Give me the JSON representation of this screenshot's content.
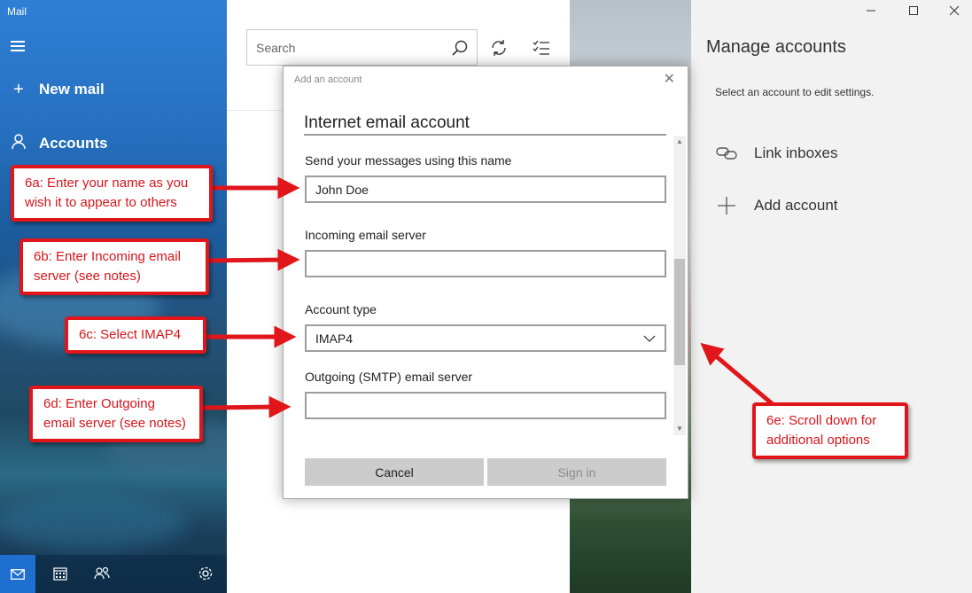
{
  "app": {
    "title": "Mail"
  },
  "nav": {
    "new_mail": "New mail",
    "accounts": "Accounts",
    "bottom_icons": [
      "mail-icon",
      "calendar-icon",
      "people-icon",
      "settings-icon"
    ]
  },
  "list": {
    "search": {
      "placeholder": "Search"
    }
  },
  "manage": {
    "title": "Manage accounts",
    "subtitle": "Select an account to edit settings.",
    "link_inboxes": "Link inboxes",
    "add_account": "Add account"
  },
  "dialog": {
    "caption": "Add an account",
    "heading": "Internet email account",
    "fields": {
      "name": {
        "label": "Send your messages using this name",
        "value": "John Doe"
      },
      "incoming": {
        "label": "Incoming email server",
        "value": ""
      },
      "account_type": {
        "label": "Account type",
        "value": "IMAP4"
      },
      "outgoing": {
        "label": "Outgoing (SMTP) email server",
        "value": ""
      }
    },
    "buttons": {
      "cancel": "Cancel",
      "sign_in": "Sign in"
    }
  },
  "callouts": {
    "a": {
      "line1": "6a: Enter your name as you",
      "line2": "wish it to appear to others"
    },
    "b": {
      "line1": "6b: Enter Incoming email",
      "line2": "server (see notes)"
    },
    "c": {
      "line1": "6c: Select IMAP4"
    },
    "d": {
      "line1": "6d: Enter Outgoing",
      "line2": "email server (see notes)"
    },
    "e": {
      "line1": "6e: Scroll down for",
      "line2": "additional options"
    }
  },
  "colors": {
    "accent": "#1e6fd0",
    "callout_red": "#e0161b",
    "dialog_border": "#a8a8a8"
  }
}
